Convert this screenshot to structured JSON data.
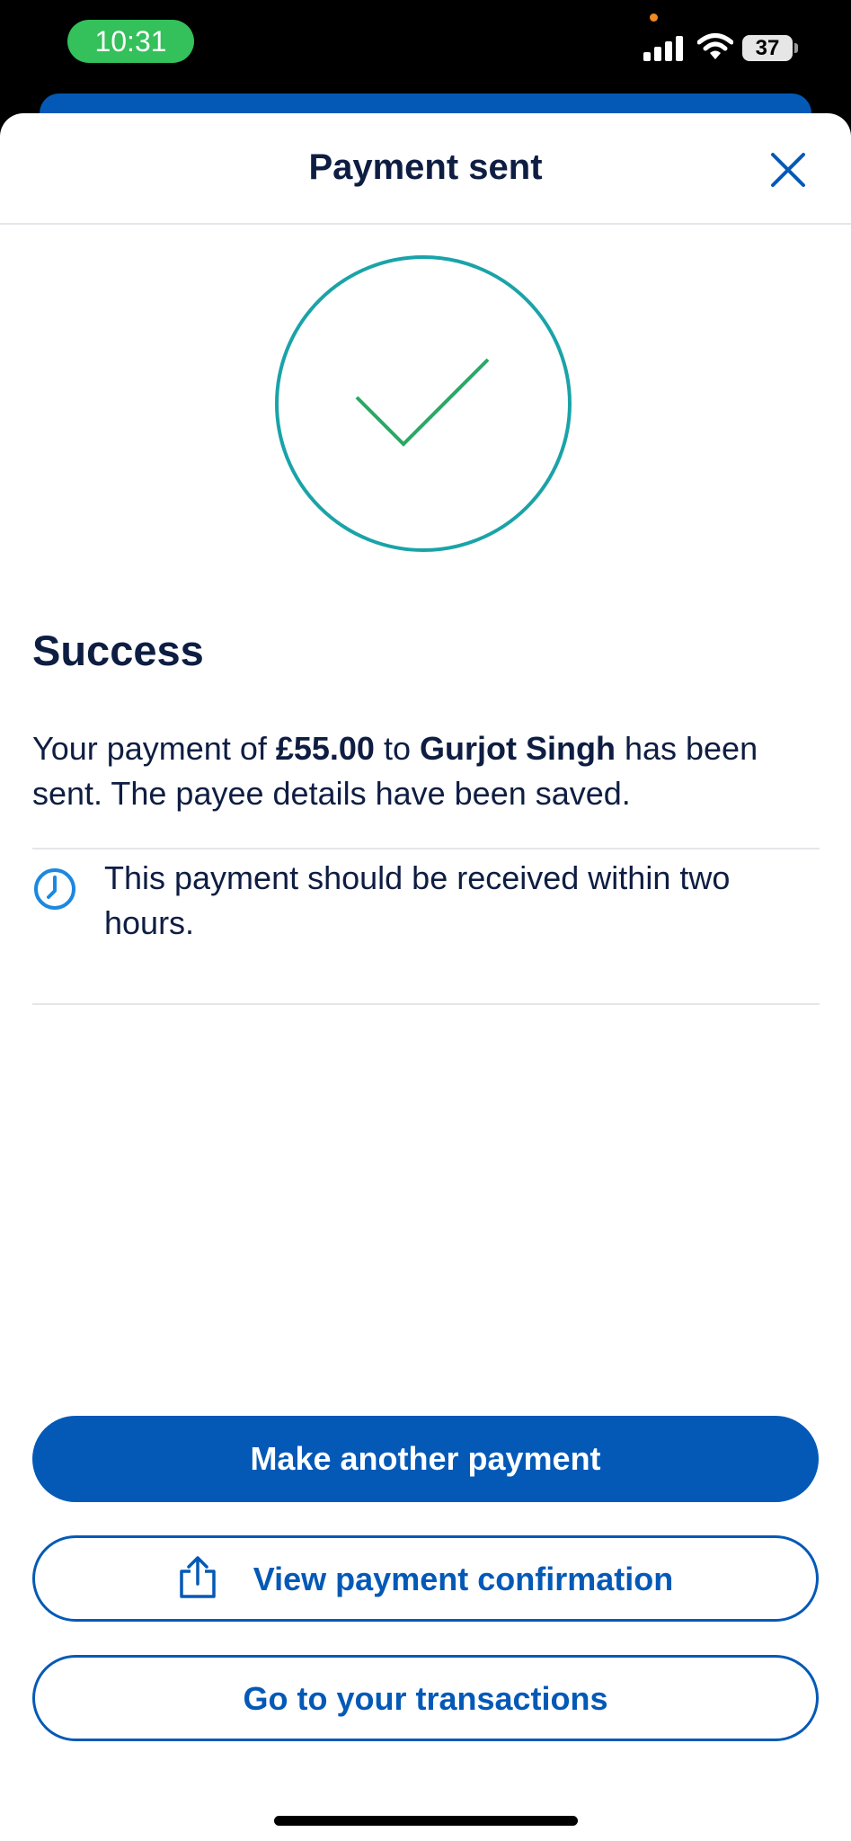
{
  "status_bar": {
    "time": "10:31",
    "battery": "37"
  },
  "header": {
    "title": "Payment sent"
  },
  "content": {
    "heading": "Success",
    "message_prefix": "Your payment of ",
    "amount": "£55.00",
    "message_middle": " to ",
    "payee": "Gurjot Singh",
    "message_suffix": " has been sent. The payee details have been saved.",
    "info_text": "This payment should be received within two hours."
  },
  "actions": {
    "primary_label": "Make another payment",
    "confirmation_label": "View payment confirmation",
    "transactions_label": "Go to your transactions"
  },
  "colors": {
    "brand_blue": "#0459b7",
    "text_navy": "#0e1d42",
    "circle_teal": "#1aa3a8",
    "check_green": "#2aa866",
    "clock_blue": "#1c88e0",
    "status_green": "#34c05a"
  },
  "icons": [
    "close-icon",
    "checkmark-icon",
    "clock-icon",
    "share-icon",
    "signal-icon",
    "wifi-icon",
    "battery-icon"
  ]
}
